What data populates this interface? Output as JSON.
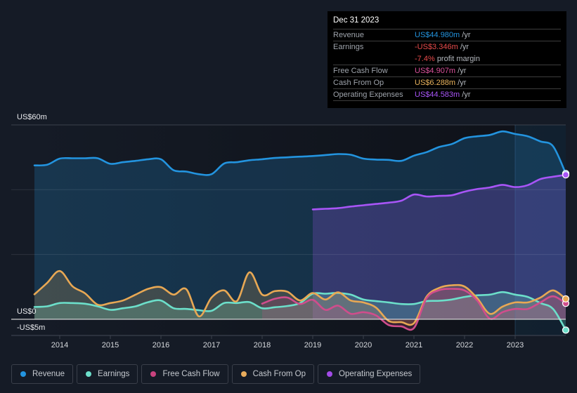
{
  "tooltip": {
    "date": "Dec 31 2023",
    "rows": [
      {
        "label": "Revenue",
        "value": "US$44.980m",
        "suffix": "/yr",
        "color": "#2394df"
      },
      {
        "label": "Earnings",
        "value": "-US$3.346m",
        "suffix": "/yr",
        "color": "#e84b4b"
      },
      {
        "label": "",
        "value": "-7.4%",
        "suffix": "profit margin",
        "color": "#e84b4b"
      },
      {
        "label": "Free Cash Flow",
        "value": "US$4.907m",
        "suffix": "/yr",
        "color": "#d9519a"
      },
      {
        "label": "Cash From Op",
        "value": "US$6.288m",
        "suffix": "/yr",
        "color": "#e8b25c"
      },
      {
        "label": "Operating Expenses",
        "value": "US$44.583m",
        "suffix": "/yr",
        "color": "#a855f7"
      }
    ]
  },
  "legend": [
    {
      "label": "Revenue",
      "color": "#2394df"
    },
    {
      "label": "Earnings",
      "color": "#6cdfca"
    },
    {
      "label": "Free Cash Flow",
      "color": "#c8437e"
    },
    {
      "label": "Cash From Op",
      "color": "#e8ac5c"
    },
    {
      "label": "Operating Expenses",
      "color": "#a24be8"
    }
  ],
  "chart_data": {
    "type": "area",
    "title": "",
    "xlabel": "",
    "ylabel": "",
    "units": "US$m",
    "xlim": [
      2013.5,
      2024.0
    ],
    "ylim": [
      -5,
      60
    ],
    "grid": true,
    "gridlines": [
      20,
      40,
      60
    ],
    "highlight_range": [
      2023.0,
      2024.0
    ],
    "x_ticks": [
      {
        "value": 2014,
        "label": "2014"
      },
      {
        "value": 2015,
        "label": "2015"
      },
      {
        "value": 2016,
        "label": "2016"
      },
      {
        "value": 2017,
        "label": "2017"
      },
      {
        "value": 2018,
        "label": "2018"
      },
      {
        "value": 2019,
        "label": "2019"
      },
      {
        "value": 2020,
        "label": "2020"
      },
      {
        "value": 2021,
        "label": "2021"
      },
      {
        "value": 2022,
        "label": "2022"
      },
      {
        "value": 2023,
        "label": "2023"
      }
    ],
    "y_ticks": [
      {
        "value": 60,
        "label": "US$60m"
      },
      {
        "value": 0,
        "label": "US$0"
      },
      {
        "value": -5,
        "label": "-US$5m"
      }
    ],
    "legend_position": "bottom",
    "series": [
      {
        "name": "Revenue",
        "key": "revenue",
        "color": "#2394df",
        "start": 2013.5,
        "step": 0.25,
        "values": [
          47.5,
          47.7,
          49.6,
          49.7,
          49.7,
          49.7,
          48.0,
          48.5,
          48.9,
          49.4,
          49.4,
          46.0,
          45.6,
          44.8,
          44.8,
          48.1,
          48.5,
          49.1,
          49.4,
          49.8,
          50.0,
          50.2,
          50.4,
          50.7,
          51.0,
          50.8,
          49.6,
          49.3,
          49.2,
          48.9,
          50.5,
          51.6,
          53.2,
          54.1,
          55.9,
          56.5,
          56.9,
          58.0,
          57.2,
          56.5,
          54.9,
          53.4,
          44.98
        ]
      },
      {
        "name": "Operating Expenses",
        "key": "opex",
        "color": "#a855f7",
        "start": 2019.0,
        "step": 0.25,
        "values": [
          33.9,
          34.1,
          34.3,
          34.8,
          35.2,
          35.6,
          36.0,
          36.6,
          38.5,
          37.9,
          38.1,
          38.3,
          39.4,
          40.2,
          40.7,
          41.5,
          40.8,
          41.4,
          43.3,
          44.0,
          44.583
        ]
      },
      {
        "name": "Earnings",
        "key": "earnings",
        "color": "#6cdfca",
        "start": 2013.5,
        "step": 0.25,
        "values": [
          3.8,
          4.0,
          5.0,
          5.0,
          4.8,
          4.0,
          2.9,
          3.4,
          4.0,
          5.3,
          5.8,
          3.4,
          3.2,
          2.8,
          2.6,
          5.0,
          5.0,
          5.3,
          3.4,
          3.7,
          4.1,
          5.0,
          7.9,
          7.9,
          8.1,
          7.6,
          6.1,
          5.6,
          5.2,
          4.7,
          4.7,
          5.6,
          5.7,
          6.1,
          6.9,
          7.4,
          7.6,
          8.4,
          7.6,
          6.9,
          5.0,
          3.2,
          -3.346
        ]
      },
      {
        "name": "Cash From Op",
        "key": "cfo",
        "color": "#e8a854",
        "start": 2013.5,
        "step": 0.25,
        "values": [
          7.7,
          11.2,
          14.9,
          10.2,
          8.0,
          4.5,
          5.0,
          5.8,
          7.6,
          9.4,
          9.9,
          7.6,
          9.3,
          0.9,
          6.7,
          8.9,
          5.6,
          14.5,
          7.6,
          8.7,
          8.5,
          5.8,
          8.1,
          6.1,
          8.3,
          5.8,
          5.2,
          3.6,
          -0.5,
          -0.9,
          -1.2,
          7.0,
          9.7,
          10.5,
          10.1,
          6.5,
          1.7,
          3.9,
          5.2,
          5.2,
          6.7,
          8.9,
          6.288
        ]
      },
      {
        "name": "Free Cash Flow",
        "key": "fcf",
        "color": "#d04d8c",
        "start": 2018.0,
        "step": 0.25,
        "values": [
          4.8,
          6.3,
          6.7,
          4.7,
          6.0,
          2.9,
          4.2,
          1.7,
          2.2,
          1.2,
          -1.8,
          -2.2,
          -2.7,
          6.5,
          9.0,
          9.4,
          8.9,
          5.8,
          0.2,
          2.2,
          3.2,
          3.2,
          5.2,
          7.1,
          4.907
        ]
      }
    ]
  }
}
